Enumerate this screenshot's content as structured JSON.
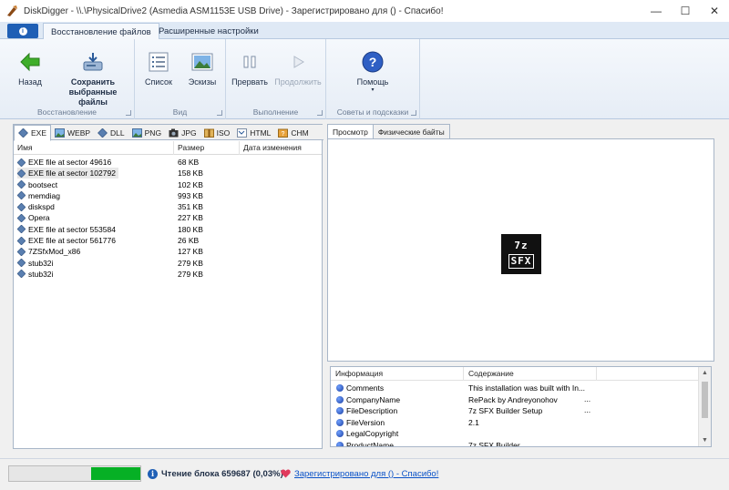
{
  "window": {
    "title": "DiskDigger - \\\\.\\PhysicalDrive2 (Asmedia ASM1153E USB Drive) - Зарегистрировано для  () - Спасибо!",
    "minimize": "—",
    "maximize": "☐",
    "close": "✕"
  },
  "ribbon_tabs": {
    "file_tab_icon": "info-icon",
    "tabs": [
      {
        "label": "Восстановление файлов",
        "active": true
      },
      {
        "label": "Расширенные настройки",
        "active": false
      }
    ]
  },
  "ribbon": {
    "groups": [
      {
        "label": "Восстановление",
        "buttons": [
          {
            "label": "Назад",
            "icon": "back-arrow-icon"
          },
          {
            "label": "Сохранить выбранные файлы",
            "lines": [
              "Сохранить",
              "выбранные",
              "файлы"
            ],
            "icon": "save-drive-icon"
          }
        ]
      },
      {
        "label": "Вид",
        "buttons": [
          {
            "label": "Список",
            "icon": "list-view-icon"
          },
          {
            "label": "Эскизы",
            "icon": "thumbnails-icon"
          }
        ]
      },
      {
        "label": "Выполнение",
        "buttons": [
          {
            "label": "Прервать",
            "icon": "pause-icon",
            "enabled": true
          },
          {
            "label": "Продолжить",
            "icon": "play-icon",
            "enabled": false
          }
        ]
      },
      {
        "label": "Советы и подсказки",
        "buttons": [
          {
            "label": "Помощь",
            "icon": "help-icon"
          }
        ]
      }
    ]
  },
  "file_type_tabs": [
    "EXE",
    "WEBP",
    "DLL",
    "PNG",
    "JPG",
    "ISO",
    "HTML",
    "CHM"
  ],
  "active_file_type": "EXE",
  "file_list": {
    "columns": [
      "Имя",
      "Размер",
      "Дата изменения"
    ],
    "rows": [
      {
        "name": "EXE file at sector 49616",
        "size": "68 KB",
        "date": ""
      },
      {
        "name": "EXE file at sector 102792",
        "size": "158 KB",
        "date": "",
        "selected": true
      },
      {
        "name": "bootsect",
        "size": "102 KB",
        "date": ""
      },
      {
        "name": "memdiag",
        "size": "993 KB",
        "date": ""
      },
      {
        "name": "diskspd",
        "size": "351 KB",
        "date": ""
      },
      {
        "name": "Opera",
        "size": "227 KB",
        "date": ""
      },
      {
        "name": "EXE file at sector 553584",
        "size": "180 KB",
        "date": ""
      },
      {
        "name": "EXE file at sector 561776",
        "size": "26 KB",
        "date": ""
      },
      {
        "name": "7ZSfxMod_x86",
        "size": "127 KB",
        "date": ""
      },
      {
        "name": "stub32i",
        "size": "279 KB",
        "date": ""
      },
      {
        "name": "stub32i",
        "size": "279 KB",
        "date": ""
      }
    ]
  },
  "preview_tabs": [
    {
      "label": "Просмотр",
      "active": true
    },
    {
      "label": "Физические байты",
      "active": false
    }
  ],
  "preview": {
    "logo_top": "7z",
    "logo_bottom": "SFX"
  },
  "info_table": {
    "columns": [
      "Информация",
      "Содержание"
    ],
    "rows": [
      {
        "key": "Comments",
        "value": "This installation was built with In...",
        "more": ""
      },
      {
        "key": "CompanyName",
        "value": "RePack by Andreyonohov",
        "more": "..."
      },
      {
        "key": "FileDescription",
        "value": "7z SFX Builder Setup",
        "more": "..."
      },
      {
        "key": "FileVersion",
        "value": "2.1",
        "more": ""
      },
      {
        "key": "LegalCopyright",
        "value": "",
        "more": ""
      },
      {
        "key": "ProductName",
        "value": "7z SFX Builder",
        "more": ""
      }
    ]
  },
  "status": {
    "progress_fraction": 0.0003,
    "progress_fill_color": "#06b025",
    "text": "Чтение блока 659687 (0,03%)",
    "registration": "Зарегистрировано для  () - Спасибо!"
  }
}
